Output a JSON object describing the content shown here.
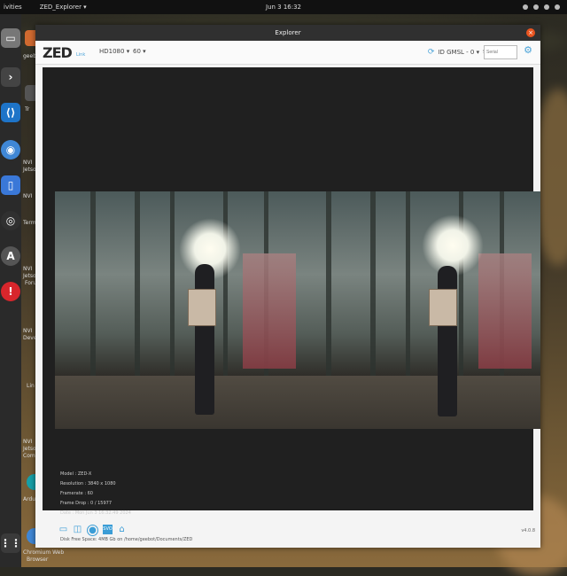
{
  "topbar": {
    "activities": "ivities",
    "app_menu": "ZED_Explorer ▾",
    "clock": "Jun 3  16:32",
    "tray_icon": "bell-icon"
  },
  "dock": {
    "items": [
      {
        "icon": "files-icon",
        "color": "#777777"
      },
      {
        "icon": "terminal-icon",
        "color": "#444444"
      },
      {
        "icon": "vscode-icon",
        "color": "#1e74c8"
      },
      {
        "icon": "chromium-icon",
        "color": "#3f87d6"
      },
      {
        "icon": "tablet-icon",
        "color": "#3a78d8"
      },
      {
        "icon": "obs-icon",
        "color": "#303030"
      },
      {
        "icon": "store-icon",
        "color": "#555555"
      },
      {
        "icon": "update-icon",
        "color": "#d8262c"
      },
      {
        "icon": "apps-grid-icon",
        "color": "#3a3a3a"
      }
    ]
  },
  "desktop": {
    "labels": [
      "geeb",
      "Tr",
      "NVI",
      "Jetson",
      "NVI",
      "Termi",
      "NVI",
      "Jetson S",
      "Foru",
      "NVI",
      "Develo",
      "Lin",
      "NVI",
      "Jetson S",
      "Communi",
      "Arduino",
      "Chromium Web",
      "Browser"
    ]
  },
  "window": {
    "title": "Explorer",
    "close_label": "×"
  },
  "toolbar": {
    "logo": "ZED",
    "logo_sub": "Link",
    "resolution": "HD1080  ▾",
    "fps": "60  ▾",
    "camera_label": "ID   GMSL - 0  ▾",
    "sn_label": "SN",
    "sn_placeholder": "Serial",
    "settings_icon": "settings-icon"
  },
  "info": {
    "model": "Model : ZED-X",
    "resolution": "Resolution : 3840 x 1080",
    "framerate": "Framerate : 60",
    "frame_drop": "Frame Drop : 0 / 15977",
    "date": "Date : Mon Jun 3 16:32:49 2024"
  },
  "bottombar": {
    "icons": [
      "folder-icon",
      "split-view-icon",
      "record-icon",
      "svo-icon",
      "snapshot-icon"
    ],
    "status": "Disk Free Space: 4MB Gb  on  /home/geebot/Documents/ZED",
    "version": "v4.0.8"
  }
}
